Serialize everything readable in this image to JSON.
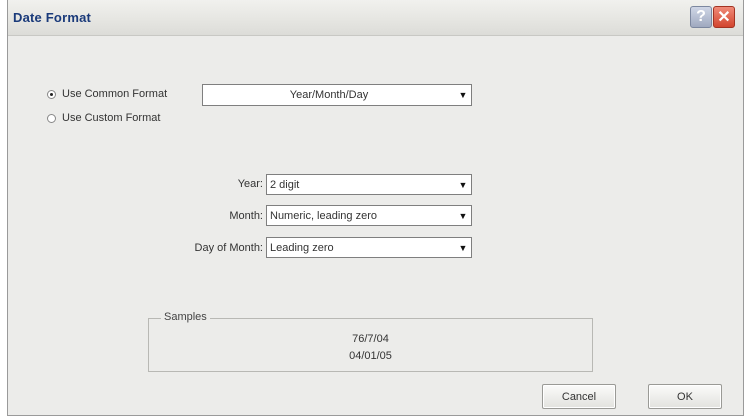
{
  "window": {
    "title": "Date Format",
    "help_glyph": "?",
    "close_glyph": "✕"
  },
  "format_type": {
    "common_label": "Use Common Format",
    "custom_label": "Use Custom Format",
    "selected": "common",
    "common_value": "Year/Month/Day"
  },
  "fields": {
    "year_label": "Year:",
    "year_value": "2 digit",
    "month_label": "Month:",
    "month_value": "Numeric, leading zero",
    "day_label": "Day of Month:",
    "day_value": "Leading zero"
  },
  "samples": {
    "legend": "Samples",
    "lines": [
      "76/7/04",
      "04/01/05"
    ]
  },
  "buttons": {
    "cancel_label": "Cancel",
    "ok_label": "OK"
  },
  "icons": {
    "dropdown_arrow": "▼"
  }
}
